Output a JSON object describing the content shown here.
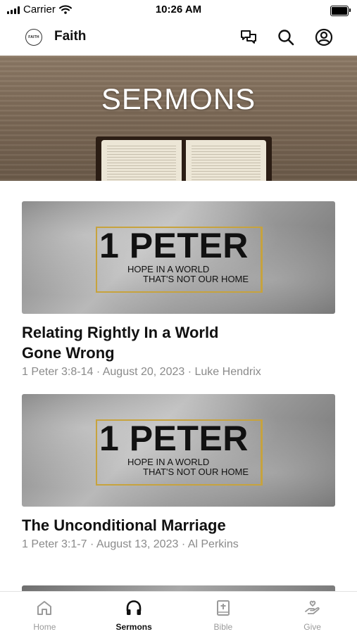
{
  "status_bar": {
    "carrier": "Carrier",
    "time": "10:26 AM"
  },
  "header": {
    "logo_text": "FAITH",
    "title": "Faith",
    "icons": [
      "chat-icon",
      "search-icon",
      "account-icon"
    ]
  },
  "hero": {
    "title": "SERMONS"
  },
  "sermons": [
    {
      "series_title": "1 PETER",
      "series_tagline_1": "HOPE IN A WORLD",
      "series_tagline_2": "THAT'S NOT OUR HOME",
      "title": "Relating Rightly In a World Gone Wrong",
      "meta": "1 Peter 3:8-14 · August 20, 2023 · Luke Hendrix"
    },
    {
      "series_title": "1 PETER",
      "series_tagline_1": "HOPE IN A WORLD",
      "series_tagline_2": "THAT'S NOT OUR HOME",
      "title": "The Unconditional Marriage",
      "meta": "1 Peter 3:1-7 · August 13, 2023 · Al Perkins"
    }
  ],
  "tab_bar": {
    "active": "Sermons",
    "tabs": [
      {
        "label": "Home",
        "icon": "home-icon"
      },
      {
        "label": "Sermons",
        "icon": "headphones-icon"
      },
      {
        "label": "Bible",
        "icon": "bible-icon"
      },
      {
        "label": "Give",
        "icon": "give-hand-icon"
      }
    ]
  },
  "colors": {
    "accent_gold": "#c7a33d",
    "meta_gray": "#8a8a8a",
    "inactive_tab": "#9a9a9a"
  }
}
